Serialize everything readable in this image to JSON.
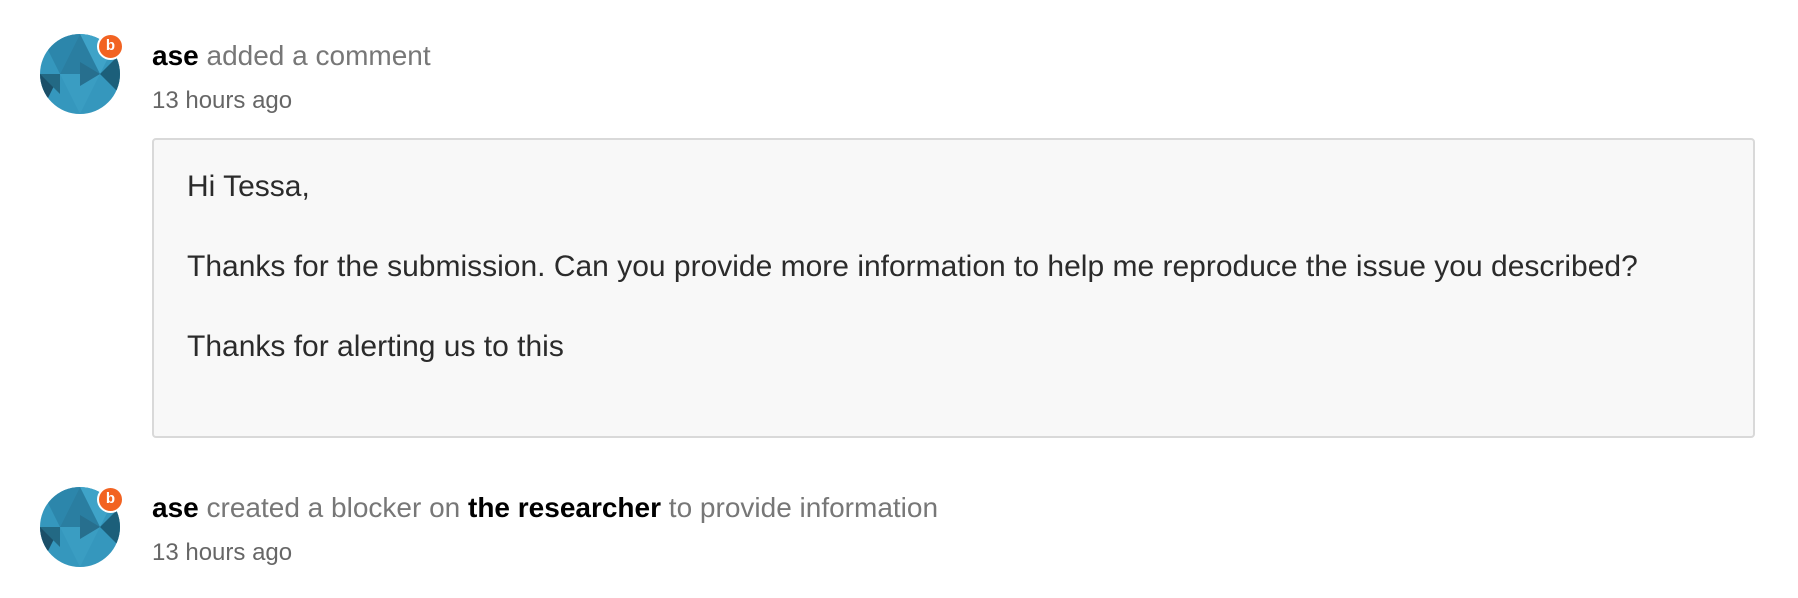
{
  "activities": [
    {
      "actor": "ase",
      "avatar_badge": "b",
      "action": "added a comment",
      "timestamp": "13 hours ago",
      "comment": {
        "paragraphs": [
          "Hi Tessa,",
          "Thanks for the submission. Can you provide more information to help me reproduce the issue you described?",
          "Thanks for alerting us to this"
        ]
      }
    },
    {
      "actor": "ase",
      "avatar_badge": "b",
      "action": "created a blocker on",
      "target": "the researcher",
      "action_suffix": "to provide information",
      "timestamp": "13 hours ago"
    }
  ],
  "colors": {
    "badge": "#f26322",
    "avatar_base": "#2e8fb4",
    "avatar_dark": "#1c5f7a",
    "muted_text": "#777777",
    "comment_background": "#f8f8f8",
    "comment_border": "#d9d9d9"
  },
  "icons": {
    "avatar": "geometric-avatar-icon",
    "badge": "program-badge-icon"
  }
}
